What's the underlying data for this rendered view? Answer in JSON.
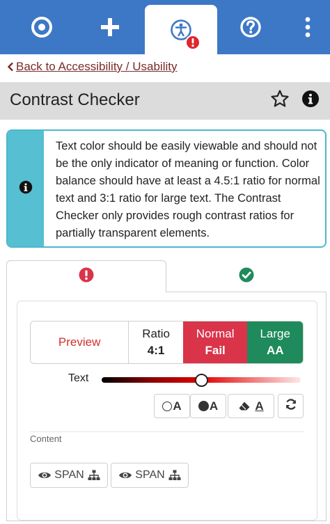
{
  "nav": {
    "items": [
      {
        "name": "target",
        "icon": "bullseye-icon"
      },
      {
        "name": "add",
        "icon": "plus-icon"
      },
      {
        "name": "accessibility",
        "icon": "accessibility-icon",
        "active": true,
        "badge": "!"
      },
      {
        "name": "help",
        "icon": "question-circle-icon"
      },
      {
        "name": "more",
        "icon": "vertical-dots-icon"
      }
    ]
  },
  "back_link": "Back to Accessibility / Usability",
  "page_title": "Contrast Checker",
  "alert": {
    "icon": "info-icon",
    "text": "Text color should be easily viewable and should not be the only indicator of meaning or function. Color balance should have at least a 4.5:1 ratio for normal text and 3:1 ratio for large text. The Contrast Checker only provides rough contrast ratios for partially transparent elements."
  },
  "tabs": [
    {
      "name": "issues",
      "icon": "exclamation-circle-icon",
      "color": "#d9344a",
      "active": true
    },
    {
      "name": "passed",
      "icon": "check-circle-icon",
      "color": "#1f8a5b",
      "active": false
    }
  ],
  "result": {
    "preview_label": "Preview",
    "ratio_label": "Ratio",
    "ratio_value": "4:1",
    "normal_label": "Normal",
    "normal_value": "Fail",
    "large_label": "Large",
    "large_value": "AA"
  },
  "slider": {
    "label": "Text",
    "value": 0.5
  },
  "tools": {
    "outline_letter": "A",
    "filled_letter": "A",
    "erase_letter": "A"
  },
  "content": {
    "label": "Content",
    "elements": [
      {
        "tag": "SPAN"
      },
      {
        "tag": "SPAN"
      }
    ]
  },
  "colors": {
    "nav_bg": "#3d78c6",
    "fail": "#d9344a",
    "pass": "#1f8a5b",
    "info_bar": "#56bfd1",
    "link": "#7a2a2a"
  }
}
